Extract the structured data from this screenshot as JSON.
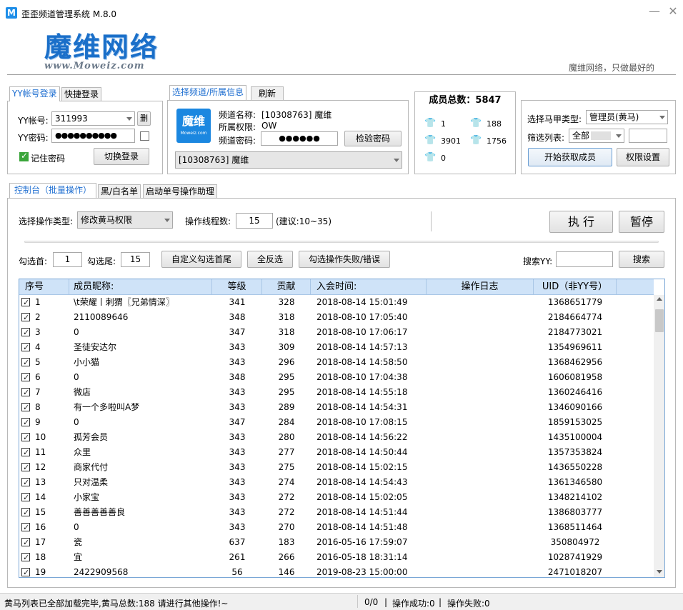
{
  "window": {
    "title": "歪歪频道管理系统 M.8.0",
    "icon_letter": "M",
    "min_glyph": "—",
    "close_glyph": "✕"
  },
  "header": {
    "logo_text": "魔维网络",
    "logo_url": "www.Moweiz.com",
    "slogan": "魔维网络，只做最好的"
  },
  "login": {
    "tabs": [
      "YY帐号登录",
      "快捷登录"
    ],
    "account_label": "YY帐号:",
    "account_value": "311993",
    "delete_label": "删",
    "password_label": "YY密码:",
    "password_value": "●●●●●●●●●●",
    "remember_label": "记住密码",
    "switch_button": "切换登录"
  },
  "channel": {
    "tabs": [
      "选择频道/所属信息",
      "刷新"
    ],
    "avatar_text": "魔维",
    "avatar_sub": "Moweiz.com",
    "name_label": "频道名称:",
    "name_value": "[10308763] 魔维",
    "perm_label": "所属权限:",
    "perm_value": "OW",
    "pwd_label": "频道密码:",
    "pwd_value": "●●●●●●",
    "check_button": "检验密码",
    "selected": "[10308763] 魔维"
  },
  "members": {
    "title": "成员总数：",
    "total": "5847",
    "stats": [
      {
        "icon": "orange-shirt-icon",
        "color": "#f08a1c",
        "value": "1"
      },
      {
        "icon": "yellow-shirt-icon",
        "color": "#f2c21a",
        "value": "188"
      },
      {
        "icon": "red-shirt-icon",
        "color": "#d9341f",
        "value": "3901"
      },
      {
        "icon": "teal-shirt-icon",
        "color": "#2fa3c9",
        "value": "1756"
      },
      {
        "icon": "green-shirt-icon",
        "color": "#2a9a2a",
        "value": "0"
      }
    ]
  },
  "vest": {
    "type_label": "选择马甲类型:",
    "type_value": "管理员(黄马)",
    "filter_label": "筛选列表:",
    "filter_value": "全部",
    "start_button": "开始获取成员",
    "perm_button": "权限设置"
  },
  "main_tabs": [
    "控制台（批量操作）",
    "黑/白名单",
    "启动单号操作助理"
  ],
  "console": {
    "op_type_label": "选择操作类型:",
    "op_type_value": "修改黄马权限",
    "threads_label": "操作线程数:",
    "threads_value": "15",
    "threads_hint": "(建议:10~35)",
    "execute_button": "执 行",
    "pause_button": "暂停",
    "first_label": "勾选首:",
    "first_value": "1",
    "last_label": "勾选尾:",
    "last_value": "15",
    "custom_button": "自定义勾选首尾",
    "invert_button": "全反选",
    "failed_button": "勾选操作失败/错误",
    "search_label": "搜索YY:",
    "search_value": "",
    "search_button": "搜索"
  },
  "table": {
    "columns": [
      "序号",
      "成员昵称:",
      "等级",
      "贡献",
      "入会时间:",
      "操作日志",
      "UID（非YY号）"
    ],
    "rows": [
      [
        "1",
        "\\t荣耀丨刺猬〖兄弟情深〗",
        "341",
        "328",
        "2018-08-14 15:01:49",
        "",
        "1368651779"
      ],
      [
        "2",
        "2110089646",
        "348",
        "318",
        "2018-08-10 17:05:40",
        "",
        "2184664774"
      ],
      [
        "3",
        "0",
        "347",
        "318",
        "2018-08-10 17:06:17",
        "",
        "2184773021"
      ],
      [
        "4",
        "圣徒安达尔",
        "343",
        "309",
        "2018-08-14 14:57:13",
        "",
        "1354969611"
      ],
      [
        "5",
        "小小猫",
        "343",
        "296",
        "2018-08-14 14:58:50",
        "",
        "1368462956"
      ],
      [
        "6",
        "0",
        "348",
        "295",
        "2018-08-10 17:04:38",
        "",
        "1606081958"
      ],
      [
        "7",
        "微店",
        "343",
        "295",
        "2018-08-14 14:55:18",
        "",
        "1360246416"
      ],
      [
        "8",
        "有一个多啦叫A梦",
        "343",
        "289",
        "2018-08-14 14:54:31",
        "",
        "1346090166"
      ],
      [
        "9",
        "0",
        "347",
        "284",
        "2018-08-10 17:08:15",
        "",
        "1859153025"
      ],
      [
        "10",
        "孤芳会员",
        "343",
        "280",
        "2018-08-14 14:56:22",
        "",
        "1435100004"
      ],
      [
        "11",
        "众里",
        "343",
        "277",
        "2018-08-14 14:50:44",
        "",
        "1357353824"
      ],
      [
        "12",
        "商家代付",
        "343",
        "275",
        "2018-08-14 15:02:15",
        "",
        "1436550228"
      ],
      [
        "13",
        "只对温柔",
        "343",
        "274",
        "2018-08-14 14:54:43",
        "",
        "1361346580"
      ],
      [
        "14",
        "小家宝",
        "343",
        "272",
        "2018-08-14 15:02:05",
        "",
        "1348214102"
      ],
      [
        "15",
        "善善善善善良",
        "343",
        "272",
        "2018-08-14 14:51:44",
        "",
        "1386803777"
      ],
      [
        "16",
        "0",
        "343",
        "270",
        "2018-08-14 14:51:48",
        "",
        "1368511464"
      ],
      [
        "17",
        "瓷",
        "637",
        "183",
        "2016-05-16 17:59:07",
        "",
        "350804972"
      ],
      [
        "18",
        "宜",
        "261",
        "266",
        "2016-05-18 18:31:14",
        "",
        "1028741929"
      ],
      [
        "19",
        "2422909568",
        "56",
        "146",
        "2019-08-23 15:00:00",
        "",
        "2471018207"
      ]
    ]
  },
  "status": {
    "message": "黄马列表已全部加载完毕,黄马总数:188 请进行其他操作!~",
    "progress": "0/0",
    "success": "操作成功:0",
    "fail": "操作失败:0",
    "sep": "|"
  }
}
